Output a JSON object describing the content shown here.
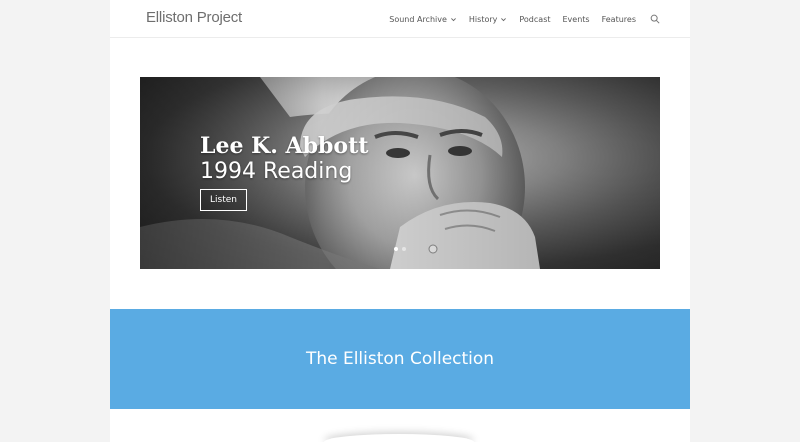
{
  "header": {
    "logo": "Elliston Project",
    "nav": [
      {
        "label": "Sound Archive",
        "has_dropdown": true
      },
      {
        "label": "History",
        "has_dropdown": true
      },
      {
        "label": "Podcast",
        "has_dropdown": false
      },
      {
        "label": "Events",
        "has_dropdown": false
      },
      {
        "label": "Features",
        "has_dropdown": false
      }
    ],
    "search_icon": "search-icon"
  },
  "hero": {
    "title": "Lee K. Abbott",
    "subtitle": "1994 Reading",
    "button_label": "Listen",
    "slides_total": 2,
    "active_slide": 1
  },
  "collection": {
    "title": "The Elliston Collection",
    "background_color": "#5aabe3"
  }
}
